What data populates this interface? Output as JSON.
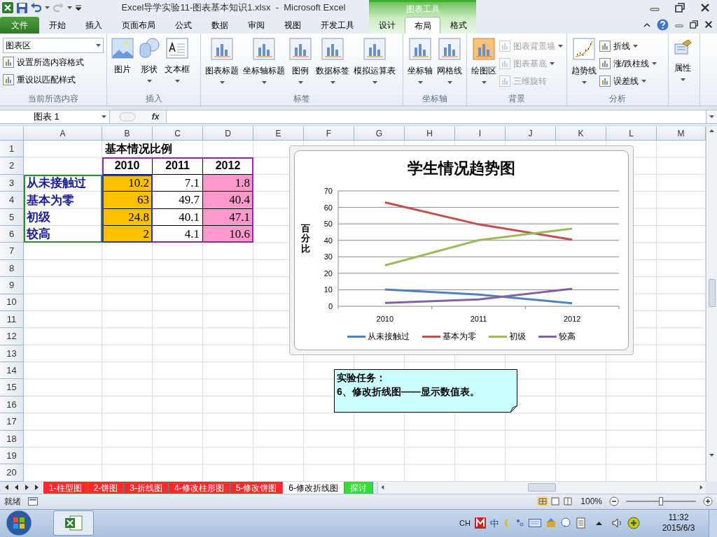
{
  "title_bar": {
    "title": "Excel导学实验11-图表基本知识1.xlsx  -  Microsoft Excel",
    "context_label": "图表工具"
  },
  "ribbon_tabs": [
    {
      "label": "文件",
      "selected": false,
      "kind": "file"
    },
    {
      "label": "开始",
      "selected": false,
      "kind": "normal"
    },
    {
      "label": "插入",
      "selected": false,
      "kind": "normal"
    },
    {
      "label": "页面布局",
      "selected": false,
      "kind": "normal"
    },
    {
      "label": "公式",
      "selected": false,
      "kind": "normal"
    },
    {
      "label": "数据",
      "selected": false,
      "kind": "normal"
    },
    {
      "label": "审阅",
      "selected": false,
      "kind": "normal"
    },
    {
      "label": "视图",
      "selected": false,
      "kind": "normal"
    },
    {
      "label": "开发工具",
      "selected": false,
      "kind": "normal"
    },
    {
      "label": "设计",
      "selected": false,
      "kind": "context"
    },
    {
      "label": "布局",
      "selected": true,
      "kind": "context"
    },
    {
      "label": "格式",
      "selected": false,
      "kind": "context"
    }
  ],
  "ribbon_groups": [
    {
      "label": "当前所选内容",
      "selector": "图表区",
      "buttons": [
        {
          "label": "设置所选内容格式",
          "kind": "small",
          "dropdown": false,
          "disabled": false
        },
        {
          "label": "重设以匹配样式",
          "kind": "small",
          "dropdown": false,
          "disabled": false
        }
      ]
    },
    {
      "label": "插入",
      "buttons": [
        {
          "label": "图片",
          "kind": "large",
          "dropdown": false,
          "disabled": false
        },
        {
          "label": "形状",
          "kind": "large",
          "dropdown": true,
          "disabled": false
        },
        {
          "label": "文本框",
          "kind": "large",
          "dropdown": true,
          "disabled": false
        }
      ]
    },
    {
      "label": "标签",
      "buttons": [
        {
          "label": "图表标题",
          "kind": "large",
          "dropdown": true,
          "disabled": false
        },
        {
          "label": "坐标轴标题",
          "kind": "large",
          "dropdown": true,
          "disabled": false
        },
        {
          "label": "图例",
          "kind": "large",
          "dropdown": true,
          "disabled": false
        },
        {
          "label": "数据标签",
          "kind": "large",
          "dropdown": true,
          "disabled": false
        },
        {
          "label": "模拟运算表",
          "kind": "large",
          "dropdown": true,
          "disabled": false
        }
      ]
    },
    {
      "label": "坐标轴",
      "buttons": [
        {
          "label": "坐标轴",
          "kind": "large",
          "dropdown": true,
          "disabled": false
        },
        {
          "label": "网格线",
          "kind": "large",
          "dropdown": true,
          "disabled": false
        }
      ]
    },
    {
      "label": "背景",
      "buttons": [
        {
          "label": "绘图区",
          "kind": "large",
          "dropdown": true,
          "disabled": false
        },
        {
          "label": "图表背景墙",
          "kind": "small",
          "dropdown": true,
          "disabled": true
        },
        {
          "label": "图表基底",
          "kind": "small",
          "dropdown": true,
          "disabled": true
        },
        {
          "label": "三维旋转",
          "kind": "small",
          "dropdown": false,
          "disabled": true
        }
      ]
    },
    {
      "label": "分析",
      "buttons": [
        {
          "label": "趋势线",
          "kind": "large",
          "dropdown": true,
          "disabled": false
        },
        {
          "label": "折线",
          "kind": "small",
          "dropdown": true,
          "disabled": false
        },
        {
          "label": "涨/跌柱线",
          "kind": "small",
          "dropdown": true,
          "disabled": false
        },
        {
          "label": "误差线",
          "kind": "small",
          "dropdown": true,
          "disabled": false
        }
      ]
    },
    {
      "buttons": [
        {
          "label": "属性",
          "kind": "large",
          "dropdown": true,
          "disabled": false
        }
      ]
    }
  ],
  "formula_bar": {
    "name_box": "图表 1",
    "function_label": "fx"
  },
  "column_headers": [
    "A",
    "B",
    "C",
    "D",
    "E",
    "F",
    "G",
    "H",
    "I",
    "J",
    "K",
    "L",
    "M"
  ],
  "row_headers": [
    "1",
    "2",
    "3",
    "4",
    "5",
    "6",
    "7",
    "8",
    "9",
    "10",
    "11",
    "12",
    "13",
    "14",
    "15",
    "16",
    "17",
    "18",
    "19",
    "20"
  ],
  "table": {
    "title": "基本情况比例",
    "columns": [
      {
        "label": "2010",
        "color": "#ffc000"
      },
      {
        "label": "2011"
      },
      {
        "label": "2012",
        "color": "#ff99cc"
      }
    ],
    "rows": [
      {
        "label": "从未接触过",
        "values": [
          "10.2",
          "7.1",
          "1.8"
        ]
      },
      {
        "label": "基本为零",
        "values": [
          "63",
          "49.7",
          "40.4"
        ]
      },
      {
        "label": "初级",
        "values": [
          "24.8",
          "40.1",
          "47.1"
        ]
      },
      {
        "label": "较高",
        "values": [
          "2",
          "4.1",
          "10.6"
        ]
      }
    ]
  },
  "chart": {
    "chart_data": {
      "type": "line",
      "title": "学生情况趋势图",
      "ylabel": "百分比",
      "categories": [
        "2010",
        "2011",
        "2012"
      ],
      "series": [
        {
          "name": "从未接触过",
          "color": "#4f81bd",
          "values": [
            10.2,
            7.1,
            1.8
          ]
        },
        {
          "name": "基本为零",
          "color": "#c0504d",
          "values": [
            63,
            49.7,
            40.4
          ]
        },
        {
          "name": "初级",
          "color": "#9bbb59",
          "values": [
            24.8,
            40.1,
            47.1
          ]
        },
        {
          "name": "较高",
          "color": "#8064a2",
          "values": [
            2,
            4.1,
            10.6
          ]
        }
      ],
      "ylim": [
        0,
        70
      ],
      "yticks": [
        0,
        10,
        20,
        30,
        40,
        50,
        60,
        70
      ],
      "grid": true,
      "legend": "bottom"
    }
  },
  "note": {
    "lines": [
      "实验任务：",
      "6、修改折线图——显示数值表。"
    ]
  },
  "sheet_tabs": [
    {
      "label": "1-柱型图",
      "selected": false,
      "color": "#ff2b2b"
    },
    {
      "label": "2-饼图",
      "selected": false,
      "color": "#ff2b2b"
    },
    {
      "label": "3-折线图",
      "selected": false,
      "color": "#ff2b2b"
    },
    {
      "label": "4-修改柱形图",
      "selected": false,
      "color": "#ff2b2b"
    },
    {
      "label": "5-修改饼图",
      "selected": false,
      "color": "#ff2b2b"
    },
    {
      "label": "6-修改折线图",
      "selected": true
    },
    {
      "label": "探讨",
      "selected": false,
      "color": "#33dd33"
    }
  ],
  "status_bar": {
    "status": "就绪",
    "zoom": "100%",
    "zoom_slider": {
      "level": 0.5
    }
  },
  "taskbar": {
    "input_language": "CH",
    "ime_mode": "中",
    "time": "11:32",
    "date": "2015/6/3"
  }
}
